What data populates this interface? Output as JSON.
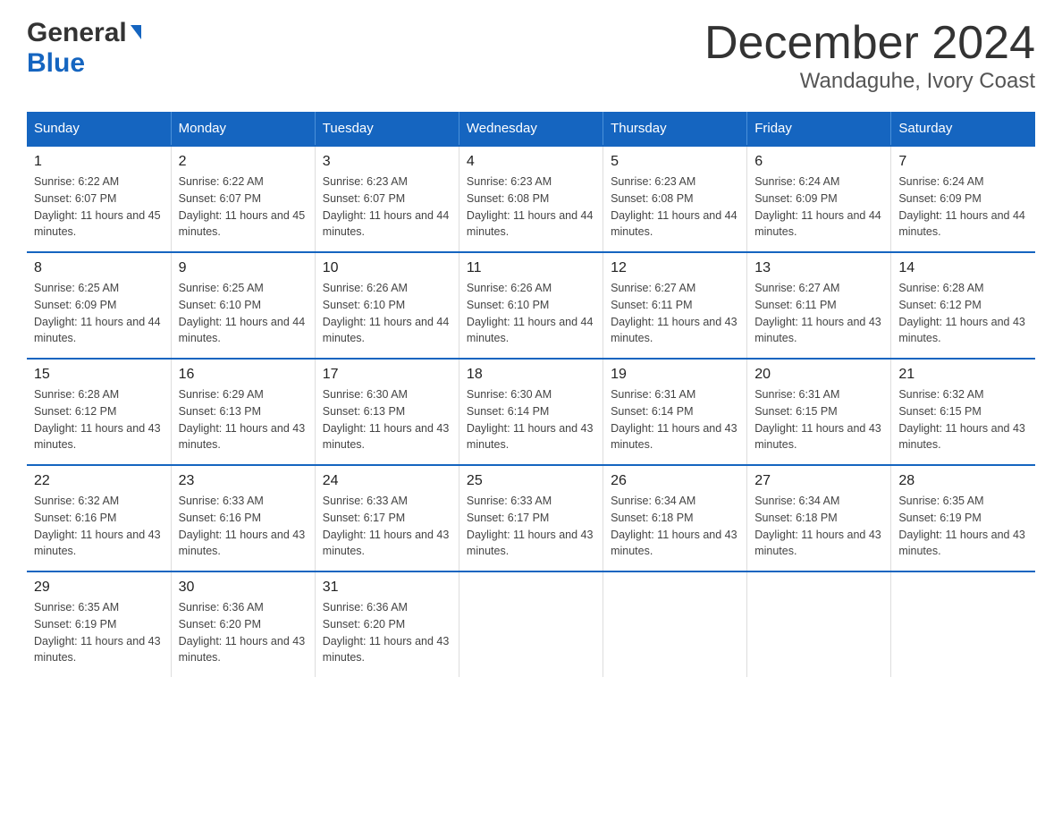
{
  "logo": {
    "general": "General",
    "blue": "Blue",
    "triangle": "▶"
  },
  "title": {
    "month": "December 2024",
    "location": "Wandaguhe, Ivory Coast"
  },
  "headers": [
    "Sunday",
    "Monday",
    "Tuesday",
    "Wednesday",
    "Thursday",
    "Friday",
    "Saturday"
  ],
  "weeks": [
    [
      {
        "day": "1",
        "sunrise": "6:22 AM",
        "sunset": "6:07 PM",
        "daylight": "11 hours and 45 minutes."
      },
      {
        "day": "2",
        "sunrise": "6:22 AM",
        "sunset": "6:07 PM",
        "daylight": "11 hours and 45 minutes."
      },
      {
        "day": "3",
        "sunrise": "6:23 AM",
        "sunset": "6:07 PM",
        "daylight": "11 hours and 44 minutes."
      },
      {
        "day": "4",
        "sunrise": "6:23 AM",
        "sunset": "6:08 PM",
        "daylight": "11 hours and 44 minutes."
      },
      {
        "day": "5",
        "sunrise": "6:23 AM",
        "sunset": "6:08 PM",
        "daylight": "11 hours and 44 minutes."
      },
      {
        "day": "6",
        "sunrise": "6:24 AM",
        "sunset": "6:09 PM",
        "daylight": "11 hours and 44 minutes."
      },
      {
        "day": "7",
        "sunrise": "6:24 AM",
        "sunset": "6:09 PM",
        "daylight": "11 hours and 44 minutes."
      }
    ],
    [
      {
        "day": "8",
        "sunrise": "6:25 AM",
        "sunset": "6:09 PM",
        "daylight": "11 hours and 44 minutes."
      },
      {
        "day": "9",
        "sunrise": "6:25 AM",
        "sunset": "6:10 PM",
        "daylight": "11 hours and 44 minutes."
      },
      {
        "day": "10",
        "sunrise": "6:26 AM",
        "sunset": "6:10 PM",
        "daylight": "11 hours and 44 minutes."
      },
      {
        "day": "11",
        "sunrise": "6:26 AM",
        "sunset": "6:10 PM",
        "daylight": "11 hours and 44 minutes."
      },
      {
        "day": "12",
        "sunrise": "6:27 AM",
        "sunset": "6:11 PM",
        "daylight": "11 hours and 43 minutes."
      },
      {
        "day": "13",
        "sunrise": "6:27 AM",
        "sunset": "6:11 PM",
        "daylight": "11 hours and 43 minutes."
      },
      {
        "day": "14",
        "sunrise": "6:28 AM",
        "sunset": "6:12 PM",
        "daylight": "11 hours and 43 minutes."
      }
    ],
    [
      {
        "day": "15",
        "sunrise": "6:28 AM",
        "sunset": "6:12 PM",
        "daylight": "11 hours and 43 minutes."
      },
      {
        "day": "16",
        "sunrise": "6:29 AM",
        "sunset": "6:13 PM",
        "daylight": "11 hours and 43 minutes."
      },
      {
        "day": "17",
        "sunrise": "6:30 AM",
        "sunset": "6:13 PM",
        "daylight": "11 hours and 43 minutes."
      },
      {
        "day": "18",
        "sunrise": "6:30 AM",
        "sunset": "6:14 PM",
        "daylight": "11 hours and 43 minutes."
      },
      {
        "day": "19",
        "sunrise": "6:31 AM",
        "sunset": "6:14 PM",
        "daylight": "11 hours and 43 minutes."
      },
      {
        "day": "20",
        "sunrise": "6:31 AM",
        "sunset": "6:15 PM",
        "daylight": "11 hours and 43 minutes."
      },
      {
        "day": "21",
        "sunrise": "6:32 AM",
        "sunset": "6:15 PM",
        "daylight": "11 hours and 43 minutes."
      }
    ],
    [
      {
        "day": "22",
        "sunrise": "6:32 AM",
        "sunset": "6:16 PM",
        "daylight": "11 hours and 43 minutes."
      },
      {
        "day": "23",
        "sunrise": "6:33 AM",
        "sunset": "6:16 PM",
        "daylight": "11 hours and 43 minutes."
      },
      {
        "day": "24",
        "sunrise": "6:33 AM",
        "sunset": "6:17 PM",
        "daylight": "11 hours and 43 minutes."
      },
      {
        "day": "25",
        "sunrise": "6:33 AM",
        "sunset": "6:17 PM",
        "daylight": "11 hours and 43 minutes."
      },
      {
        "day": "26",
        "sunrise": "6:34 AM",
        "sunset": "6:18 PM",
        "daylight": "11 hours and 43 minutes."
      },
      {
        "day": "27",
        "sunrise": "6:34 AM",
        "sunset": "6:18 PM",
        "daylight": "11 hours and 43 minutes."
      },
      {
        "day": "28",
        "sunrise": "6:35 AM",
        "sunset": "6:19 PM",
        "daylight": "11 hours and 43 minutes."
      }
    ],
    [
      {
        "day": "29",
        "sunrise": "6:35 AM",
        "sunset": "6:19 PM",
        "daylight": "11 hours and 43 minutes."
      },
      {
        "day": "30",
        "sunrise": "6:36 AM",
        "sunset": "6:20 PM",
        "daylight": "11 hours and 43 minutes."
      },
      {
        "day": "31",
        "sunrise": "6:36 AM",
        "sunset": "6:20 PM",
        "daylight": "11 hours and 43 minutes."
      },
      null,
      null,
      null,
      null
    ]
  ]
}
